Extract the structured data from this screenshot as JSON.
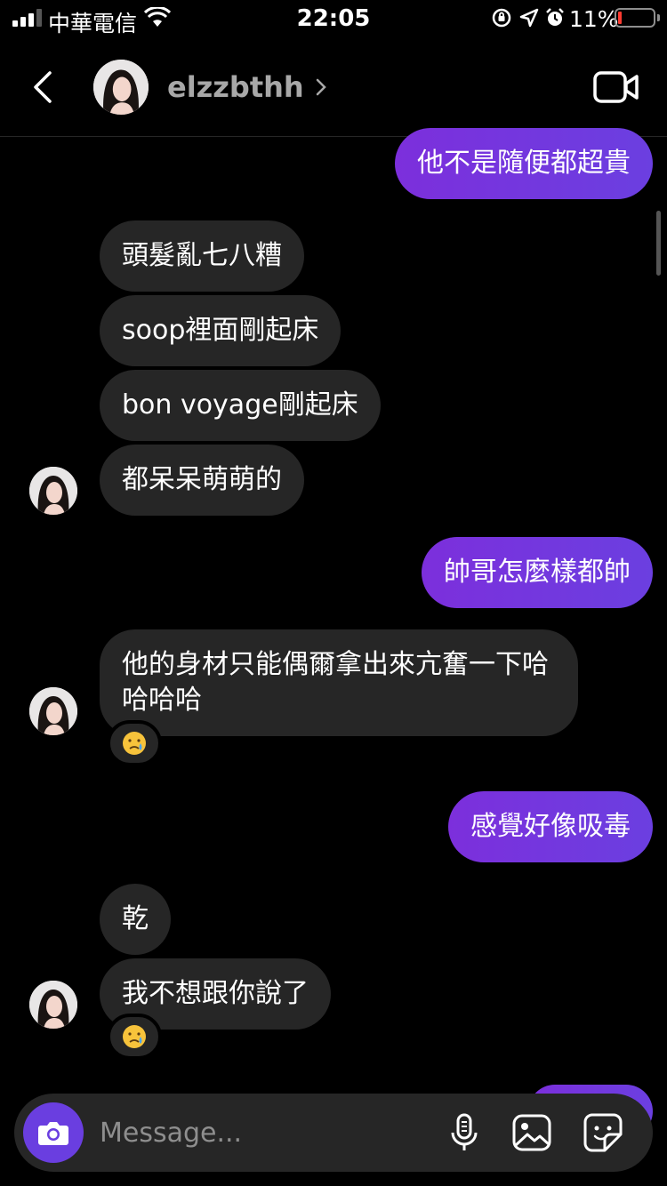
{
  "status_bar": {
    "carrier": "中華電信",
    "time": "22:05",
    "battery_percent": "11%",
    "battery_level": 0.11,
    "signal_bars": 3,
    "icons": [
      "wifi-icon",
      "orientation-lock-icon",
      "location-icon",
      "alarm-icon"
    ]
  },
  "header": {
    "username": "elzzbthh",
    "icons": [
      "back-icon",
      "chevron-right-icon",
      "video-call-icon"
    ]
  },
  "messages": {
    "m1": "他不是隨便都超貴",
    "m2": "頭髮亂七八糟",
    "m3": "soop裡面剛起床",
    "m4": "bon voyage剛起床",
    "m5": "都呆呆萌萌的",
    "m6": "帥哥怎麼樣都帥",
    "m7": "他的身材只能偶爾拿出來亢奮一下哈哈哈哈",
    "m8": "感覺好像吸毒",
    "m9": "乾",
    "m10": "我不想跟你說了",
    "reaction": "😢"
  },
  "composer": {
    "placeholder": "Message...",
    "icons": [
      "camera-icon",
      "microphone-icon",
      "image-icon",
      "sticker-icon"
    ]
  },
  "colors": {
    "sent_bubble": "#7b3ae0",
    "received_bubble": "#262626",
    "camera_button": "#6a3ee0",
    "background": "#000000"
  }
}
